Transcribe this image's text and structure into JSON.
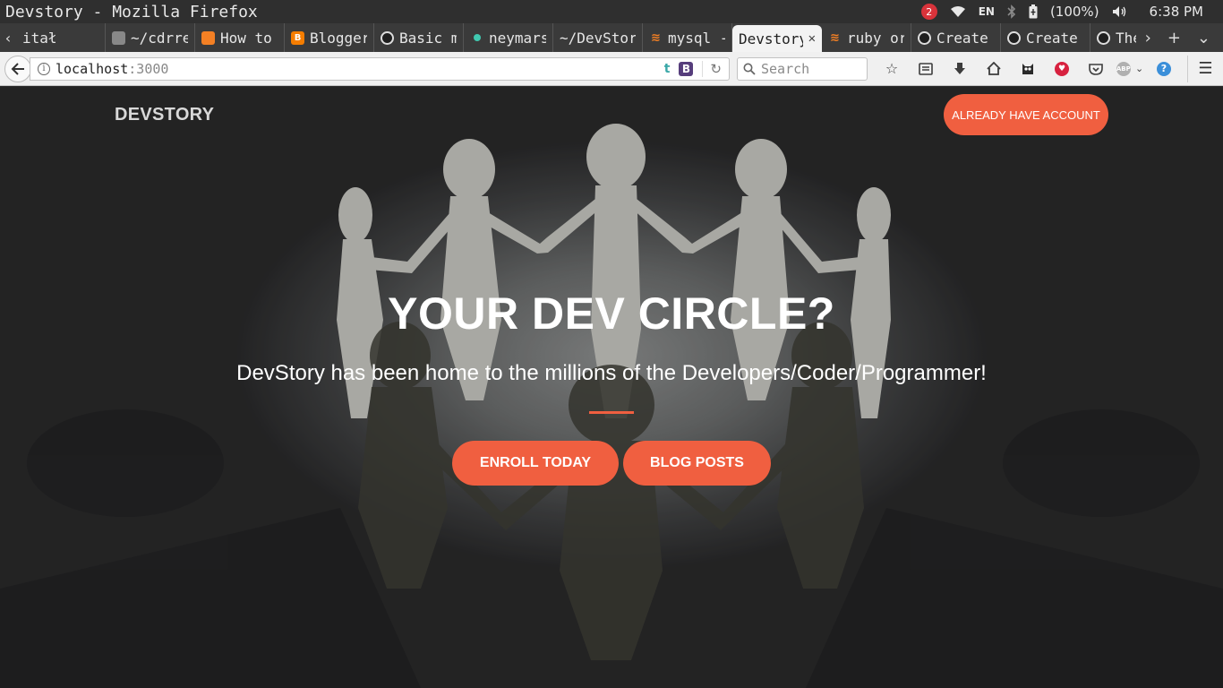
{
  "window": {
    "title": "Devstory - Mozilla Firefox"
  },
  "tray": {
    "notification_count": "2",
    "language": "EN",
    "battery": "(100%)",
    "time": "6:38 PM"
  },
  "tabs": [
    {
      "label": "itał",
      "icon": "none-icon"
    },
    {
      "label": "~/cdrre",
      "icon": "terminal-icon"
    },
    {
      "label": "How to",
      "icon": "stackexchange-icon"
    },
    {
      "label": "Blogger",
      "icon": "blogger-icon"
    },
    {
      "label": "Basic m",
      "icon": "github-icon"
    },
    {
      "label": "neymars",
      "icon": "dot-icon"
    },
    {
      "label": "~/DevStor",
      "icon": "none-icon"
    },
    {
      "label": "mysql -",
      "icon": "stackoverflow-icon"
    },
    {
      "label": "Devstory",
      "icon": "none-icon",
      "active": true
    },
    {
      "label": "ruby or",
      "icon": "stackoverflow-icon"
    },
    {
      "label": "Create",
      "icon": "github-icon"
    },
    {
      "label": "Create",
      "icon": "github-icon"
    },
    {
      "label": "These c",
      "icon": "github-icon"
    }
  ],
  "urlbar": {
    "host": "localhost",
    "port": ":3000"
  },
  "search": {
    "placeholder": "Search"
  },
  "page": {
    "brand": "DEVSTORY",
    "account_button": "ALREADY HAVE ACCOUNT",
    "hero_title": "YOUR DEV CIRCLE?",
    "hero_subtitle": "DevStory has been home to the millions of the Developers/Coder/Programmer!",
    "enroll_button": "ENROLL TODAY",
    "blog_button": "BLOG POSTS"
  },
  "colors": {
    "accent": "#f05f40",
    "brand_text": "#d8d8d8"
  }
}
